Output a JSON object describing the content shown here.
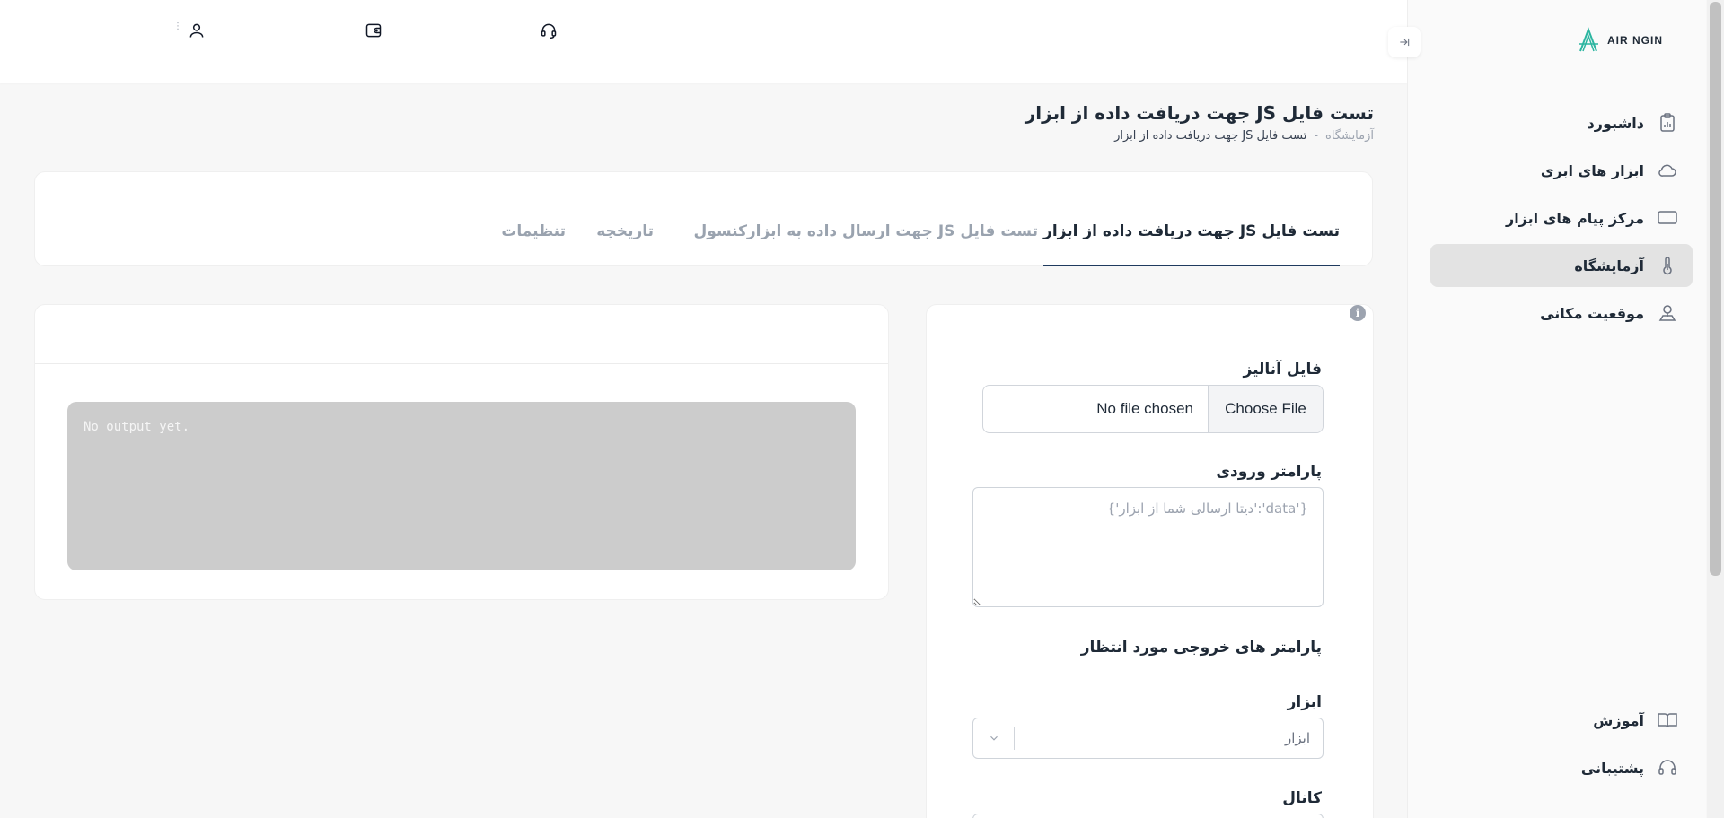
{
  "topbar": {
    "icons": [
      "support-headset-icon",
      "wallet-icon",
      "user-icon",
      "more-vertical-icon"
    ]
  },
  "sidebar": {
    "logo_text": "AIR NGIN",
    "items": [
      {
        "label": "داشبورد",
        "icon": "dashboard-clipboard-icon",
        "active": false
      },
      {
        "label": "ابزار های ابری",
        "icon": "cloud-icon",
        "active": false
      },
      {
        "label": "مرکز پیام های ابزار",
        "icon": "message-icon",
        "active": false
      },
      {
        "label": "آزمایشگاه",
        "icon": "thermometer-icon",
        "active": true
      },
      {
        "label": "موقعیت مکانی",
        "icon": "location-pin-icon",
        "active": false
      }
    ],
    "bottom_items": [
      {
        "label": "آموزش",
        "icon": "book-icon"
      },
      {
        "label": "پشتیبانی",
        "icon": "headset-icon"
      }
    ]
  },
  "page": {
    "title": "تست فایل JS جهت دریافت داده از ابزار",
    "breadcrumb": {
      "root": "آزمایشگاه",
      "separator": "-",
      "current": "تست فایل JS جهت دریافت داده از ابزار"
    }
  },
  "tabs": [
    {
      "label": "تست فایل JS جهت دریافت داده از ابزار",
      "active": true
    },
    {
      "label": "تست فایل JS جهت ارسال داده به ابزار",
      "active": false
    },
    {
      "label": "کنسول",
      "active": false
    },
    {
      "label": "تاریخچه",
      "active": false
    },
    {
      "label": "تنظیمات",
      "active": false
    }
  ],
  "output": {
    "text": "No output yet."
  },
  "form": {
    "file_label": "فایل آنالیز",
    "file_button": "Choose File",
    "file_status": "No file chosen",
    "input_param_label": "پارامتر ورودی",
    "input_param_placeholder": "{'data':'دیتا ارسالی شما از ابزار'}",
    "expected_output_label": "پارامتر های خروجی مورد انتظار",
    "tool_label": "ابزار",
    "tool_placeholder": "ابزار",
    "channel_label": "کانال"
  },
  "colors": {
    "accent": "#1f3a5f",
    "active_nav_bg": "#e3e3e3",
    "output_bg": "#cccccc"
  }
}
